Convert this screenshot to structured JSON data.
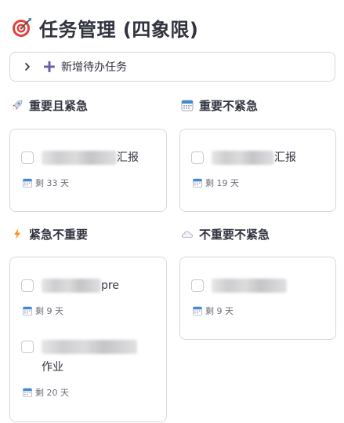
{
  "page": {
    "title": "任务管理 (四象限)"
  },
  "expander": {
    "label": "新增待办任务"
  },
  "quadrants": {
    "q1": {
      "label": "重要且紧急",
      "tasks": [
        {
          "text_visible_suffix": "汇报",
          "days_left": "剩 33 天"
        }
      ]
    },
    "q2": {
      "label": "重要不紧急",
      "tasks": [
        {
          "text_visible_suffix": "汇报",
          "days_left": "剩 19 天"
        }
      ]
    },
    "q3": {
      "label": "紧急不重要",
      "tasks": [
        {
          "text_visible_suffix": "pre",
          "days_left": "剩 9 天"
        },
        {
          "text_visible_line2": "作业",
          "days_left": "剩 20 天"
        }
      ]
    },
    "q4": {
      "label": "不重要不紧急",
      "tasks": [
        {
          "days_left": "剩 9 天"
        }
      ]
    }
  },
  "colors": {
    "text": "#31333f",
    "muted": "#6b6e78",
    "border": "#d7d9e0",
    "plus_purple": "#6e5fa6",
    "calendar_blue": "#3d8bd6",
    "lightning_orange": "#f7941d",
    "target_red": "#e0413f"
  },
  "icons": {
    "title": "target-dart-icon",
    "expander_chevron": "chevron-right-icon",
    "expander_add": "plus-icon",
    "q1": "rocket-icon",
    "q2": "calendar-icon",
    "q3": "lightning-icon",
    "q4": "cloud-icon"
  }
}
